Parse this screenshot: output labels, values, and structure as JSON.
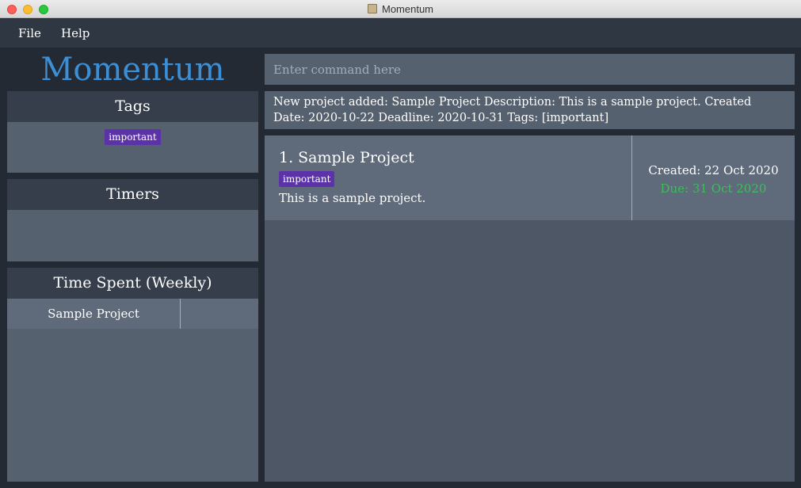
{
  "window": {
    "title": "Momentum"
  },
  "menu": {
    "file": "File",
    "help": "Help"
  },
  "sidebar": {
    "brand": "Momentum",
    "tags_header": "Tags",
    "tags": [
      "important"
    ],
    "timers_header": "Timers",
    "time_spent_header": "Time Spent (Weekly)",
    "time_spent_rows": [
      {
        "project": "Sample Project",
        "time": ""
      }
    ]
  },
  "command": {
    "placeholder": "Enter command here",
    "value": ""
  },
  "result": {
    "message": "New project added: Sample Project Description: This is a sample project. Created Date: 2020-10-22 Deadline: 2020-10-31 Tags: [important]"
  },
  "projects": [
    {
      "title": "1. Sample Project",
      "tag": "important",
      "description": "This is a sample project.",
      "created": "Created: 22 Oct 2020",
      "due": "Due: 31 Oct 2020"
    }
  ],
  "colors": {
    "brand": "#3b8fd6",
    "tag": "#5b32a8",
    "due": "#3dbd5d",
    "panel": "#566170",
    "header": "#353e4a"
  },
  "icons": {
    "app": "momentum-app-icon"
  }
}
